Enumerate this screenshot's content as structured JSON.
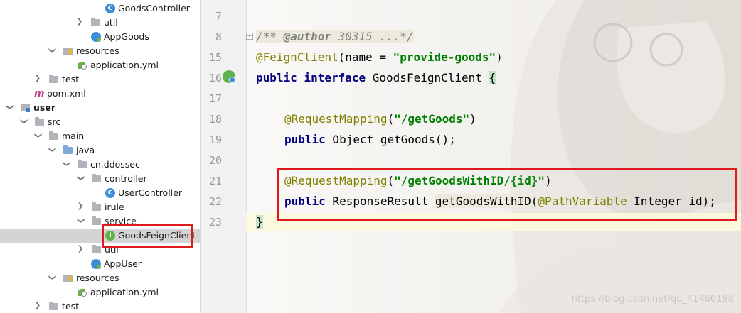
{
  "tree": {
    "items": [
      {
        "label": "GoodsController",
        "icon": "class-icon",
        "glyph": "C"
      },
      {
        "label": "util",
        "icon": "folder-icon"
      },
      {
        "label": "AppGoods",
        "icon": "spring-boot-class-icon"
      },
      {
        "label": "resources",
        "icon": "resources-folder-icon"
      },
      {
        "label": "application.yml",
        "icon": "yaml-file-icon"
      },
      {
        "label": "test",
        "icon": "folder-icon"
      },
      {
        "label": "pom.xml",
        "icon": "maven-icon",
        "glyph": "m"
      },
      {
        "label": "user",
        "icon": "module-folder-icon"
      },
      {
        "label": "src",
        "icon": "folder-icon"
      },
      {
        "label": "main",
        "icon": "folder-icon"
      },
      {
        "label": "java",
        "icon": "source-folder-icon"
      },
      {
        "label": "cn.ddossec",
        "icon": "package-icon"
      },
      {
        "label": "controller",
        "icon": "package-icon"
      },
      {
        "label": "UserController",
        "icon": "class-icon",
        "glyph": "C"
      },
      {
        "label": "irule",
        "icon": "package-icon"
      },
      {
        "label": "service",
        "icon": "package-icon"
      },
      {
        "label": "GoodsFeignClient",
        "icon": "interface-icon",
        "glyph": "I"
      },
      {
        "label": "util",
        "icon": "package-icon"
      },
      {
        "label": "AppUser",
        "icon": "spring-boot-class-icon"
      },
      {
        "label": "resources",
        "icon": "resources-folder-icon"
      },
      {
        "label": "application.yml",
        "icon": "yaml-file-icon"
      },
      {
        "label": "test",
        "icon": "folder-icon"
      }
    ],
    "selected": "GoodsFeignClient"
  },
  "editor": {
    "line_numbers": [
      "7",
      "8",
      "15",
      "16",
      "17",
      "18",
      "19",
      "20",
      "21",
      "22",
      "23"
    ],
    "code": {
      "l8_comment_open": "/** ",
      "l8_author_tag": "@author",
      "l8_comment_rest": " 30315 ...*/",
      "l15_annotation": "@FeignClient",
      "l15_open": "(name = ",
      "l15_string": "\"provide-goods\"",
      "l15_close": ")",
      "l16_public": "public",
      "l16_interface": "interface",
      "l16_name": " GoodsFeignClient ",
      "l16_brace": "{",
      "l18_annotation": "@RequestMapping",
      "l18_open": "(",
      "l18_string": "\"/getGoods\"",
      "l18_close": ")",
      "l19_public": "public",
      "l19_rest": " Object getGoods();",
      "l21_annotation": "@RequestMapping",
      "l21_open": "(",
      "l21_string": "\"/getGoodsWithID/{id}\"",
      "l21_close": ")",
      "l22_public": "public",
      "l22_type": " ResponseResult ",
      "l22_method": "getGoodsWithID",
      "l22_open": "(",
      "l22_annotation": "@PathVariable",
      "l22_rest": " Integer id);",
      "l23_brace": "}"
    },
    "watermark": "https://blog.csdn.net/qq_41460198"
  },
  "colors": {
    "keyword": "#000080",
    "annotation": "#808000",
    "string": "#008000",
    "comment": "#808080",
    "highlight_box": "#e0191e",
    "selection": "#d4d4d4"
  }
}
